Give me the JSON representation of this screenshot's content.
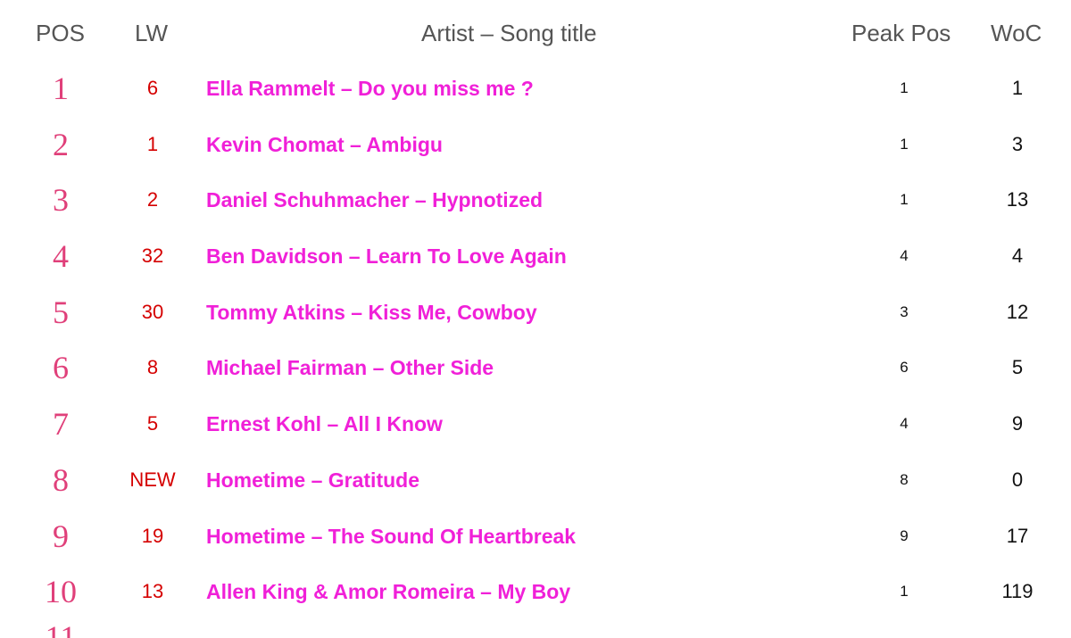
{
  "headers": {
    "pos": "POS",
    "lw": "LW",
    "title": "Artist – Song title",
    "peak": "Peak Pos",
    "woc": "WoC"
  },
  "rows": [
    {
      "pos": "1",
      "lw": "6",
      "title": "Ella Rammelt – Do you miss me ?",
      "peak": "1",
      "woc": "1"
    },
    {
      "pos": "2",
      "lw": "1",
      "title": "Kevin Chomat – Ambigu",
      "peak": "1",
      "woc": "3"
    },
    {
      "pos": "3",
      "lw": "2",
      "title": "Daniel Schuhmacher – Hypnotized",
      "peak": "1",
      "woc": "13"
    },
    {
      "pos": "4",
      "lw": "32",
      "title": "Ben Davidson – Learn To Love Again",
      "peak": "4",
      "woc": "4"
    },
    {
      "pos": "5",
      "lw": "30",
      "title": "Tommy Atkins – Kiss Me, Cowboy",
      "peak": "3",
      "woc": "12"
    },
    {
      "pos": "6",
      "lw": "8",
      "title": "Michael Fairman – Other Side",
      "peak": "6",
      "woc": "5"
    },
    {
      "pos": "7",
      "lw": "5",
      "title": "Ernest Kohl – All I Know",
      "peak": "4",
      "woc": "9"
    },
    {
      "pos": "8",
      "lw": "NEW",
      "title": "Hometime – Gratitude",
      "peak": "8",
      "woc": "0"
    },
    {
      "pos": "9",
      "lw": "19",
      "title": "Hometime – The Sound Of Heartbreak",
      "peak": "9",
      "woc": "17"
    },
    {
      "pos": "10",
      "lw": "13",
      "title": "Allen King & Amor Romeira – My Boy",
      "peak": "1",
      "woc": "119"
    }
  ],
  "partial_row": {
    "pos": "11"
  },
  "colors": {
    "position": "#e0407a",
    "last_week": "#d50000",
    "title": "#f020d8",
    "header": "#555555",
    "text": "#111111"
  }
}
